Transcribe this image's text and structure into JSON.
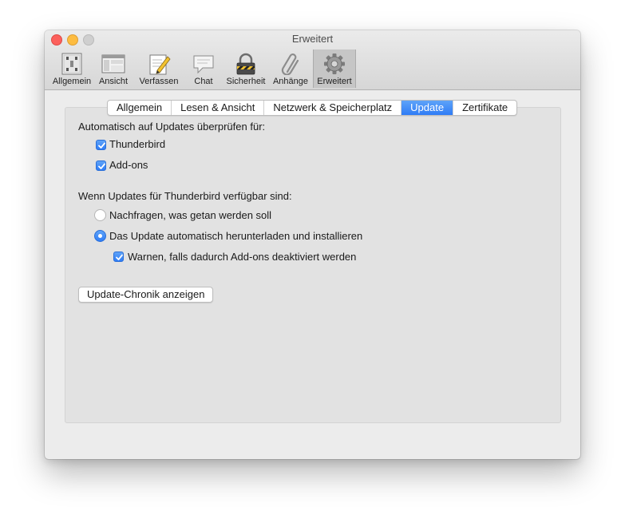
{
  "window": {
    "title": "Erweitert"
  },
  "toolbar": {
    "items": [
      {
        "label": "Allgemein",
        "icon": "switch-panel-icon"
      },
      {
        "label": "Ansicht",
        "icon": "window-layout-icon"
      },
      {
        "label": "Verfassen",
        "icon": "pencil-paper-icon"
      },
      {
        "label": "Chat",
        "icon": "chat-bubble-icon"
      },
      {
        "label": "Sicherheit",
        "icon": "padlock-icon"
      },
      {
        "label": "Anhänge",
        "icon": "paperclip-icon"
      },
      {
        "label": "Erweitert",
        "icon": "gear-icon"
      }
    ],
    "selected": "Erweitert"
  },
  "tabs": {
    "items": [
      "Allgemein",
      "Lesen & Ansicht",
      "Netzwerk & Speicherplatz",
      "Update",
      "Zertifikate"
    ],
    "active": "Update"
  },
  "update": {
    "check_heading": "Automatisch auf Updates überprüfen für:",
    "thunderbird_label": "Thunderbird",
    "thunderbird_checked": true,
    "addons_label": "Add-ons",
    "addons_checked": true,
    "when_heading": "Wenn Updates für Thunderbird verfügbar sind:",
    "ask_label": "Nachfragen, was getan werden soll",
    "ask_selected": false,
    "auto_label": "Das Update automatisch herunterladen und installieren",
    "auto_selected": true,
    "warn_label": "Warnen, falls dadurch Add-ons deaktiviert werden",
    "warn_checked": true,
    "history_button": "Update-Chronik anzeigen"
  },
  "colors": {
    "accent": "#2f7cf6",
    "close": "#fc605c",
    "minimize": "#fdbc40",
    "zoom_disabled": "#cfcfcf"
  }
}
